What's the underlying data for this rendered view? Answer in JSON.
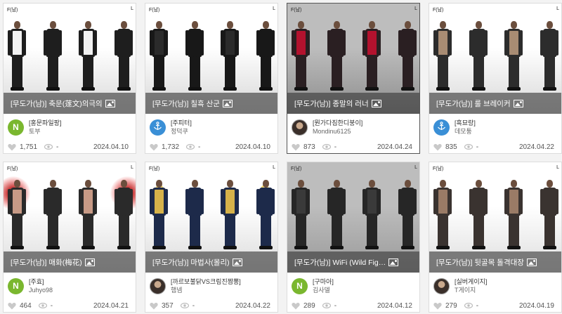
{
  "cards": [
    {
      "tag_left": "F(남)",
      "tag_right": "L",
      "title": "[무도가(남)] 축문(蓫文)의극의",
      "group": "[홍문파일팡]",
      "author": "토부",
      "avatar": {
        "kind": "letter",
        "letter": "N",
        "color": "#7ab72f"
      },
      "likes": "1,751",
      "views": "-",
      "date": "2024.04.10",
      "theme": {
        "bg_top": "#ffffff",
        "bg_bottom": "#d9d9d9",
        "body": "#1e1e1e",
        "accent": "#f2f2f2",
        "halo": ""
      }
    },
    {
      "tag_left": "F(남)",
      "tag_right": "L",
      "title": "[무도가(남)] 칠흑 산군",
      "group": "[주피터]",
      "author": "정덕쿠",
      "avatar": {
        "kind": "anchor",
        "color": "#3a8fd6"
      },
      "likes": "1,732",
      "views": "-",
      "date": "2024.04.10",
      "theme": {
        "bg_top": "#ffffff",
        "bg_bottom": "#d6d6d6",
        "body": "#181818",
        "accent": "#2b2b2b",
        "halo": ""
      }
    },
    {
      "tag_left": "F(남)",
      "tag_right": "L",
      "title": "[무도가(남)] 종말의 러너",
      "group": "[뭔가다짐한디붕이]",
      "author": "Mondinu6125",
      "avatar": {
        "kind": "photo"
      },
      "likes": "873",
      "views": "-",
      "date": "2024.04.24",
      "selected": true,
      "theme": {
        "bg_top": "#bdbdbd",
        "bg_bottom": "#8e8e8e",
        "body": "#2a1f22",
        "accent": "#b3122e",
        "halo": ""
      }
    },
    {
      "tag_left": "F(남)",
      "tag_right": "L",
      "title": "[무도가(남)] 룰 브레이커",
      "group": "[흑묘랑]",
      "author": "데모퉁",
      "avatar": {
        "kind": "anchor",
        "color": "#3a8fd6"
      },
      "likes": "835",
      "views": "-",
      "date": "2024.04.22",
      "theme": {
        "bg_top": "#ffffff",
        "bg_bottom": "#d8d8d8",
        "body": "#2c2c2c",
        "accent": "#a88c73",
        "halo": ""
      }
    },
    {
      "tag_left": "F(남)",
      "tag_right": "L",
      "title": "[무도가(남)] 매화(梅花)",
      "group": "[주효]",
      "author": "Juhyo98",
      "avatar": {
        "kind": "letter",
        "letter": "N",
        "color": "#7ab72f"
      },
      "likes": "464",
      "views": "-",
      "date": "2024.04.21",
      "theme": {
        "bg_top": "#ffffff",
        "bg_bottom": "#dcdcdc",
        "body": "#2a2a2a",
        "accent": "#c79a86",
        "halo": "#e23b3b"
      }
    },
    {
      "tag_left": "F(남)",
      "tag_right": "L",
      "title": "[무도가(남)] 마법사(몰리)",
      "group": "[까르보불닭VS크림진짬뽕]",
      "author": "햄넴",
      "avatar": {
        "kind": "photo"
      },
      "likes": "357",
      "views": "-",
      "date": "2024.04.22",
      "theme": {
        "bg_top": "#ffffff",
        "bg_bottom": "#dadada",
        "body": "#1d2a4a",
        "accent": "#d6b24a",
        "halo": "#f3d15a"
      }
    },
    {
      "tag_left": "F(남)",
      "tag_right": "L",
      "title": "[무도가(남)] WiFi (Wild Fig…",
      "group": "[구마아]",
      "author": "김사델",
      "avatar": {
        "kind": "letter",
        "letter": "N",
        "color": "#7ab72f"
      },
      "likes": "289",
      "views": "-",
      "date": "2024.04.12",
      "theme": {
        "bg_top": "#bdbdbd",
        "bg_bottom": "#9a9a9a",
        "body": "#262626",
        "accent": "#3a3a3a",
        "halo": ""
      }
    },
    {
      "tag_left": "F(남)",
      "tag_right": "L",
      "title": "[무도가(남)] 뒷골목 돌격대장",
      "group": "[실버게이지]",
      "author": "T게이지",
      "avatar": {
        "kind": "photo"
      },
      "likes": "279",
      "views": "-",
      "date": "2024.04.19",
      "theme": {
        "bg_top": "#ffffff",
        "bg_bottom": "#dedede",
        "body": "#3a3330",
        "accent": "#9a7b66",
        "halo": ""
      }
    }
  ]
}
